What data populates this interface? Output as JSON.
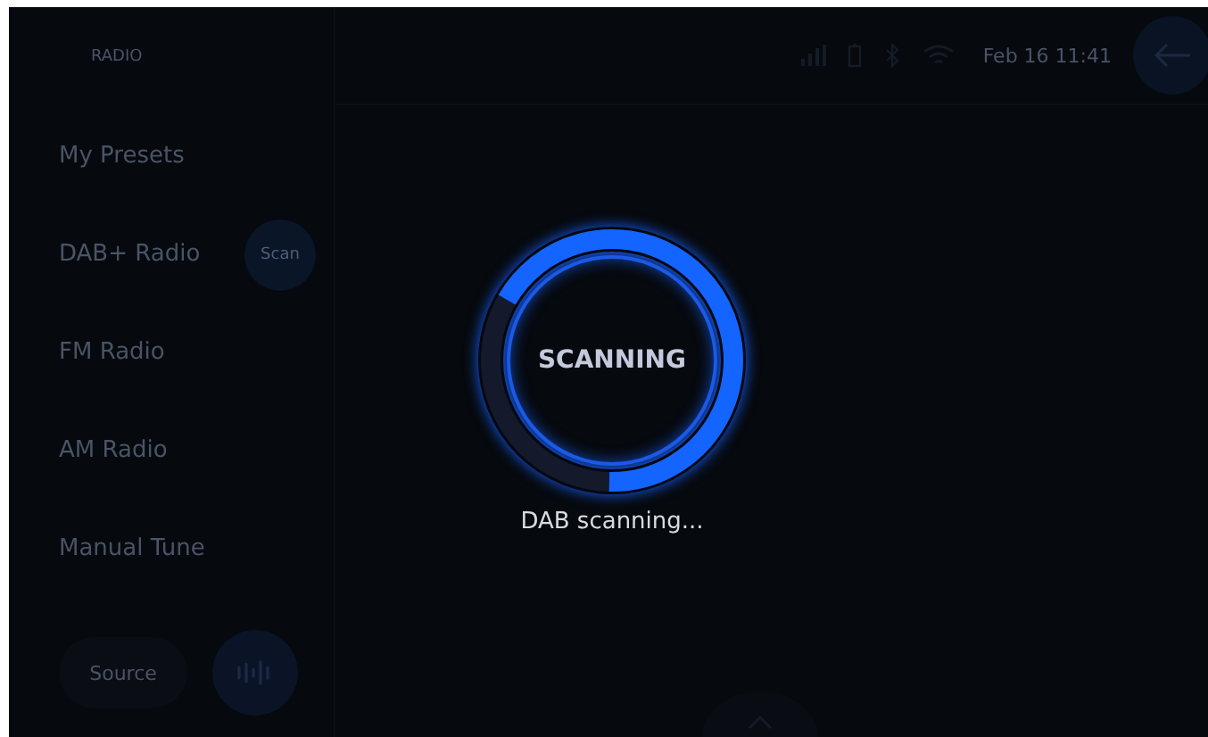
{
  "header": {
    "title": "RADIO"
  },
  "status_bar": {
    "datetime": "Feb 16 11:41"
  },
  "menu": [
    {
      "label": "My Presets"
    },
    {
      "label": "DAB+ Radio",
      "action": "Scan"
    },
    {
      "label": "FM Radio"
    },
    {
      "label": "AM Radio"
    },
    {
      "label": "Manual Tune"
    }
  ],
  "bottom": {
    "source_button": "Source"
  },
  "scan_dialog": {
    "title": "SCANNING",
    "level": 0.67,
    "message": "DAB scanning..."
  }
}
